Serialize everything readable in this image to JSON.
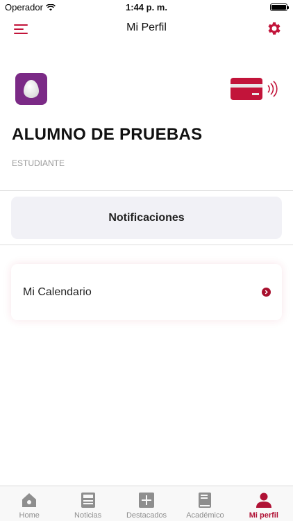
{
  "status_bar": {
    "carrier": "Operador",
    "time": "1:44 p. m.",
    "battery_level": 1.0
  },
  "nav": {
    "title": "Mi Perfil",
    "menu_icon": "hamburger-menu-icon",
    "settings_icon": "gear-icon"
  },
  "profile": {
    "name": "ALUMNO DE PRUEBAS",
    "role": "ESTUDIANTE",
    "logo_icon": "egg-logo-icon",
    "card_icon": "nfc-card-icon"
  },
  "actions": {
    "notifications_label": "Notificaciones",
    "calendar_label": "Mi Calendario"
  },
  "tabs": [
    {
      "label": "Home",
      "icon": "home-icon",
      "active": false
    },
    {
      "label": "Noticias",
      "icon": "news-icon",
      "active": false
    },
    {
      "label": "Destacados",
      "icon": "plus-icon",
      "active": false
    },
    {
      "label": "Académico",
      "icon": "book-icon",
      "active": false
    },
    {
      "label": "Mi perfil",
      "icon": "person-icon",
      "active": true
    }
  ],
  "colors": {
    "accent": "#c2143a",
    "logo_bg": "#7b2a86",
    "tab_inactive": "#8e8e8e"
  }
}
